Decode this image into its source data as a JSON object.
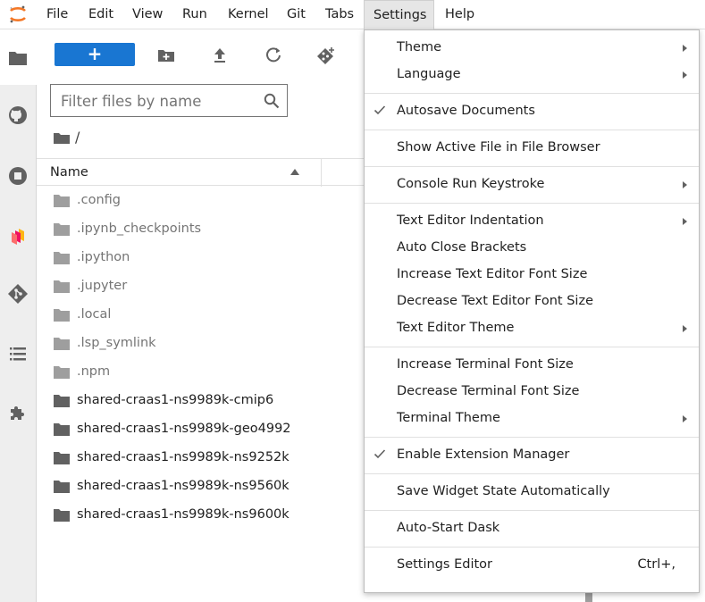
{
  "menubar": {
    "items": [
      {
        "label": "File"
      },
      {
        "label": "Edit"
      },
      {
        "label": "View"
      },
      {
        "label": "Run"
      },
      {
        "label": "Kernel"
      },
      {
        "label": "Git"
      },
      {
        "label": "Tabs"
      },
      {
        "label": "Settings"
      },
      {
        "label": "Help"
      }
    ],
    "active": "Settings"
  },
  "activity": {
    "icons": [
      "folder-icon",
      "github-icon",
      "stop-icon",
      "dask-icon",
      "git-icon",
      "list-icon",
      "extension-icon"
    ]
  },
  "filebrowser": {
    "new_label": "+",
    "search_placeholder": "Filter files by name",
    "breadcrumb": "/",
    "column_name": "Name",
    "files": [
      {
        "name": ".config",
        "hidden": true
      },
      {
        "name": ".ipynb_checkpoints",
        "hidden": true
      },
      {
        "name": ".ipython",
        "hidden": true
      },
      {
        "name": ".jupyter",
        "hidden": true
      },
      {
        "name": ".local",
        "hidden": true
      },
      {
        "name": ".lsp_symlink",
        "hidden": true
      },
      {
        "name": ".npm",
        "hidden": true
      },
      {
        "name": "shared-craas1-ns9989k-cmip6",
        "hidden": false
      },
      {
        "name": "shared-craas1-ns9989k-geo4992",
        "hidden": false
      },
      {
        "name": "shared-craas1-ns9989k-ns9252k",
        "hidden": false
      },
      {
        "name": "shared-craas1-ns9989k-ns9560k",
        "hidden": false
      },
      {
        "name": "shared-craas1-ns9989k-ns9600k",
        "hidden": false
      }
    ]
  },
  "settings_menu": {
    "groups": [
      [
        {
          "label": "Theme",
          "submenu": true
        },
        {
          "label": "Language",
          "submenu": true
        }
      ],
      [
        {
          "label": "Autosave Documents",
          "checked": true
        }
      ],
      [
        {
          "label": "Show Active File in File Browser"
        }
      ],
      [
        {
          "label": "Console Run Keystroke",
          "submenu": true
        }
      ],
      [
        {
          "label": "Text Editor Indentation",
          "submenu": true
        },
        {
          "label": "Auto Close Brackets"
        },
        {
          "label": "Increase Text Editor Font Size"
        },
        {
          "label": "Decrease Text Editor Font Size"
        },
        {
          "label": "Text Editor Theme",
          "submenu": true
        }
      ],
      [
        {
          "label": "Increase Terminal Font Size"
        },
        {
          "label": "Decrease Terminal Font Size"
        },
        {
          "label": "Terminal Theme",
          "submenu": true
        }
      ],
      [
        {
          "label": "Enable Extension Manager",
          "checked": true
        }
      ],
      [
        {
          "label": "Save Widget State Automatically"
        }
      ],
      [
        {
          "label": "Auto-Start Dask"
        }
      ],
      [
        {
          "label": "Settings Editor",
          "shortcut": "Ctrl+,"
        }
      ]
    ]
  },
  "colors": {
    "accent": "#1976d2",
    "jupyter_orange": "#f37726",
    "menu_active_bg": "#e6e6e6",
    "hidden_text": "#757575"
  }
}
